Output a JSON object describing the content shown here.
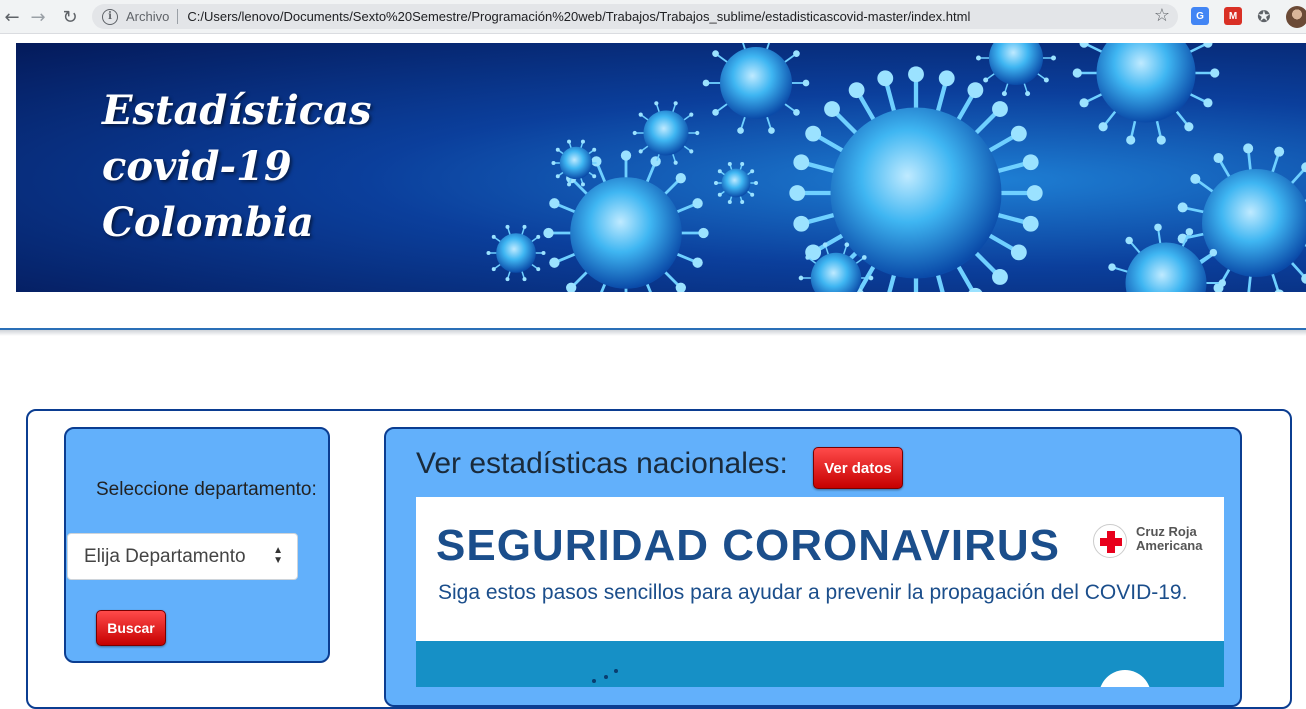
{
  "browser": {
    "site_label": "Archivo",
    "url": "C:/Users/lenovo/Documents/Sexto%20Semestre/Programación%20web/Trabajos/Trabajos_sublime/estadisticascovid-master/index.html",
    "icons": [
      "back-arrow-icon",
      "forward-arrow-icon",
      "reload-icon",
      "info-icon",
      "star-icon",
      "translate-icon",
      "extension-icon",
      "puzzle-icon",
      "profile-avatar"
    ]
  },
  "banner": {
    "title_lines": [
      "Estadísticas",
      "covid-19",
      "Colombia"
    ]
  },
  "sidebar": {
    "label": "Seleccione departamento:",
    "select_value": "Elija Departamento",
    "search_button": "Buscar"
  },
  "content": {
    "heading": "Ver estadísticas nacionales:",
    "view_button": "Ver datos",
    "infographic": {
      "title": "SEGURIDAD CORONAVIRUS",
      "subtitle": "Siga estos pasos sencillos para ayudar a prevenir la propagación del COVID-19.",
      "logo_text": "Cruz Roja Americana"
    }
  },
  "colors": {
    "panel_blue": "#62b0fb",
    "border_navy": "#0b3d91",
    "button_red": "#c60000",
    "infographic_blue": "#1b4e8b"
  }
}
